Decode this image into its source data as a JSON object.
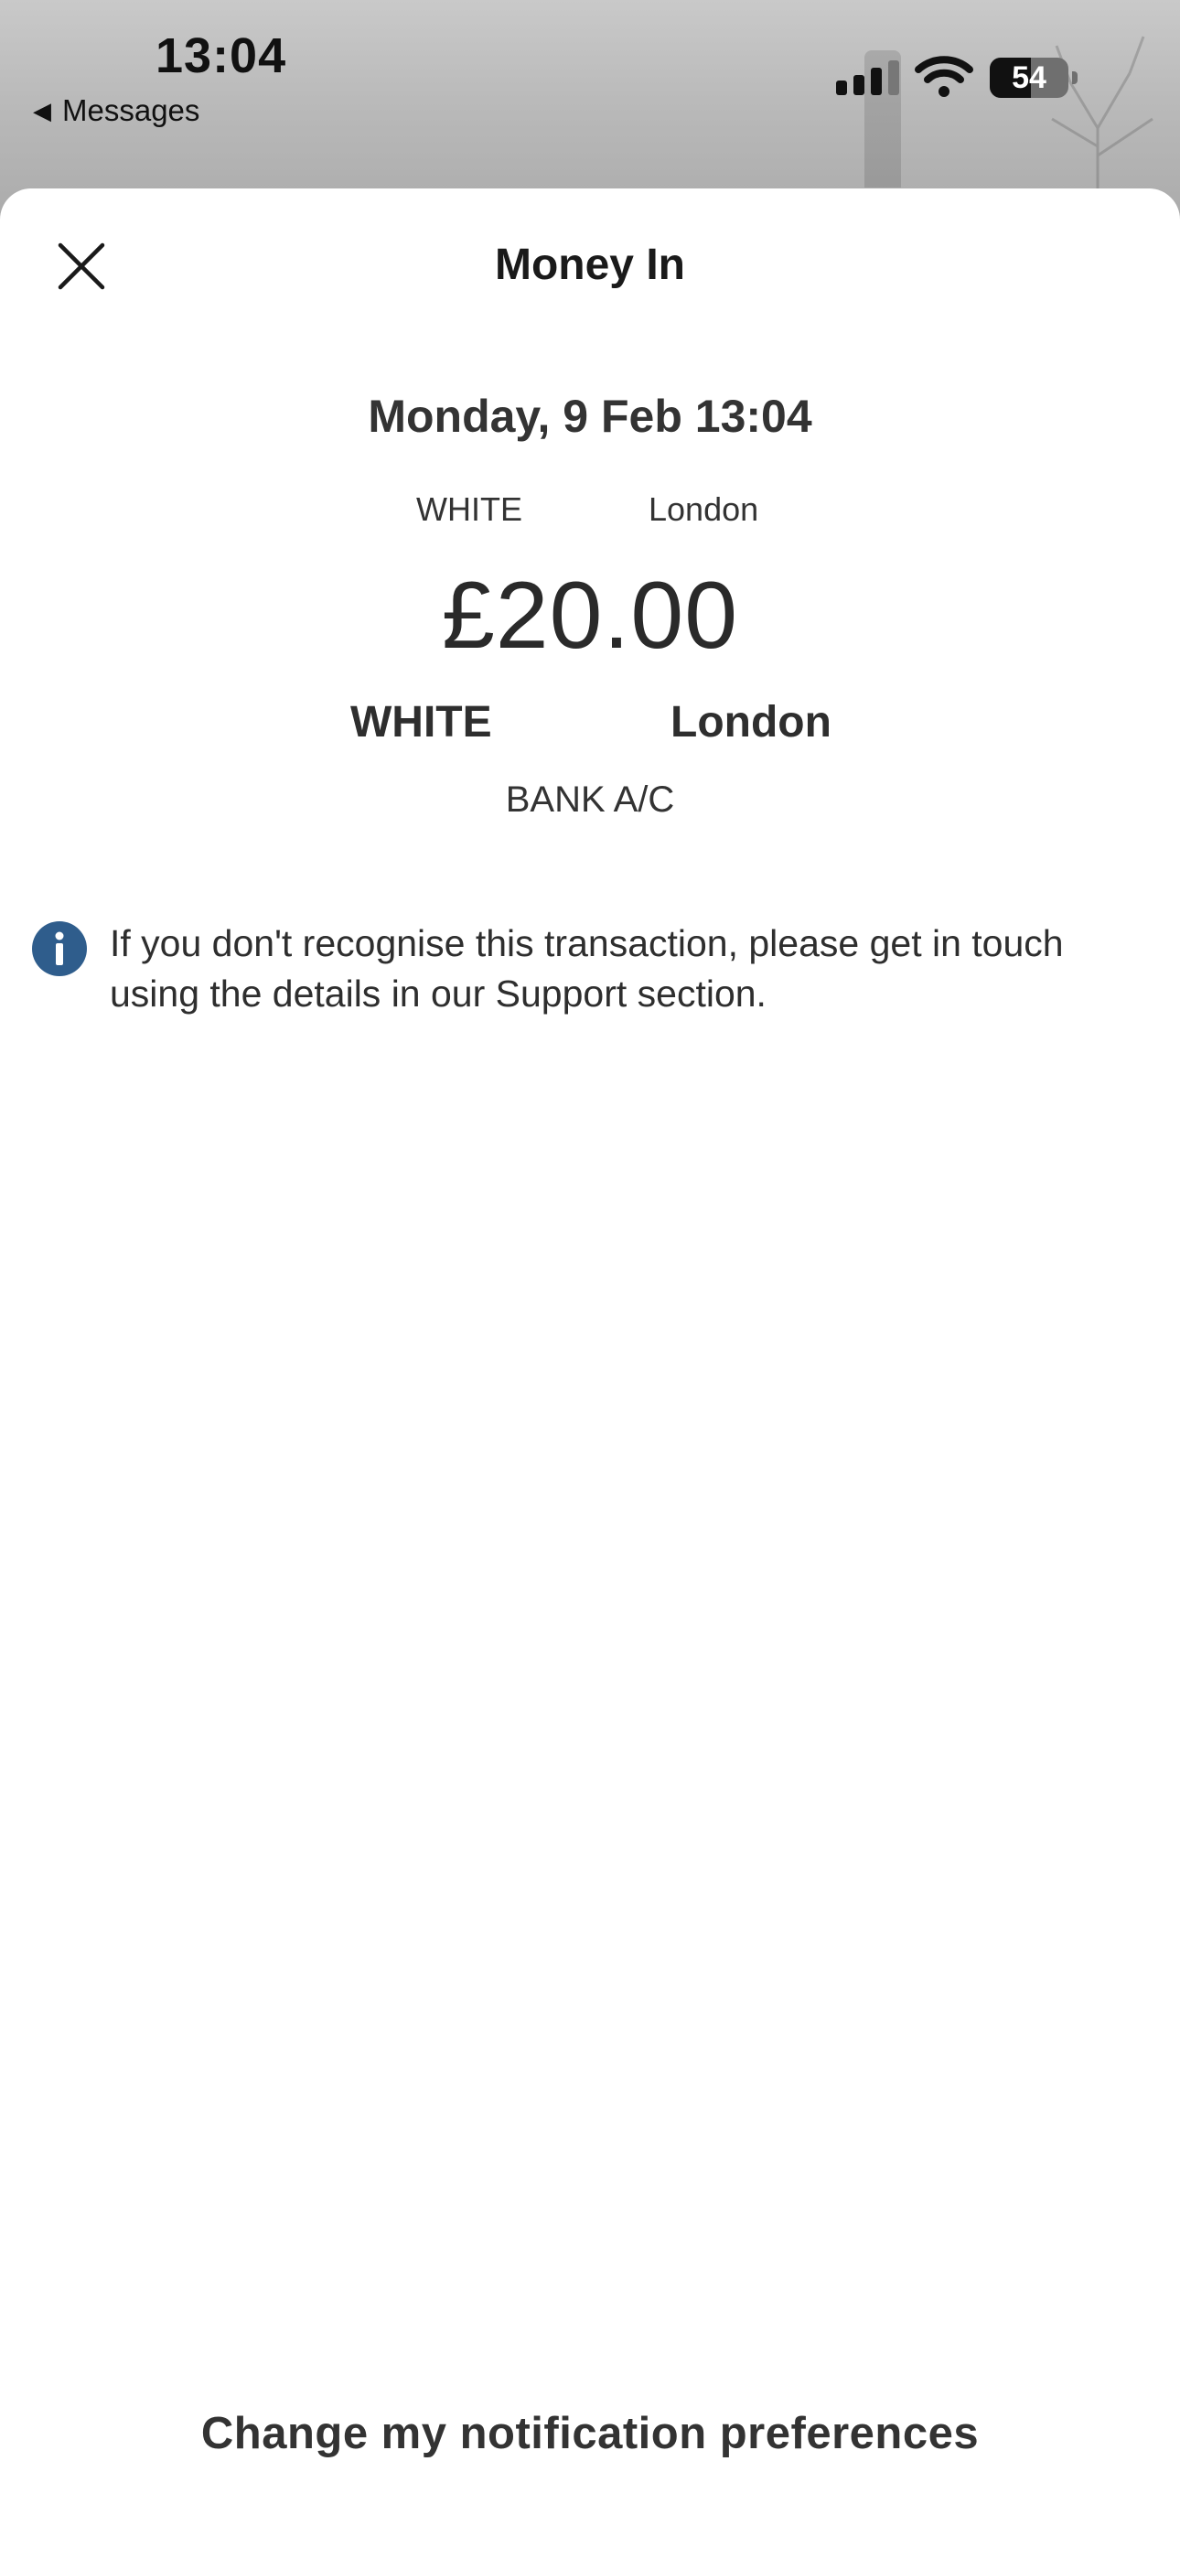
{
  "status_bar": {
    "time": "13:04",
    "back_label": "Messages",
    "battery_level": "54"
  },
  "sheet": {
    "title": "Money In",
    "close_icon": "close-icon"
  },
  "transaction": {
    "datetime": "Monday, 9 Feb 13:04",
    "reference_name": "WHITE",
    "reference_location": "London",
    "amount": "£20.00",
    "payer_name": "WHITE",
    "payer_location": "London",
    "account_type": "BANK A/C"
  },
  "notice": {
    "icon": "info-icon",
    "text": "If you don't recognise this transaction, please get in touch using the details in our Support section.",
    "icon_color": "#2f5d8c"
  },
  "footer": {
    "preferences_link": "Change my notification preferences"
  }
}
